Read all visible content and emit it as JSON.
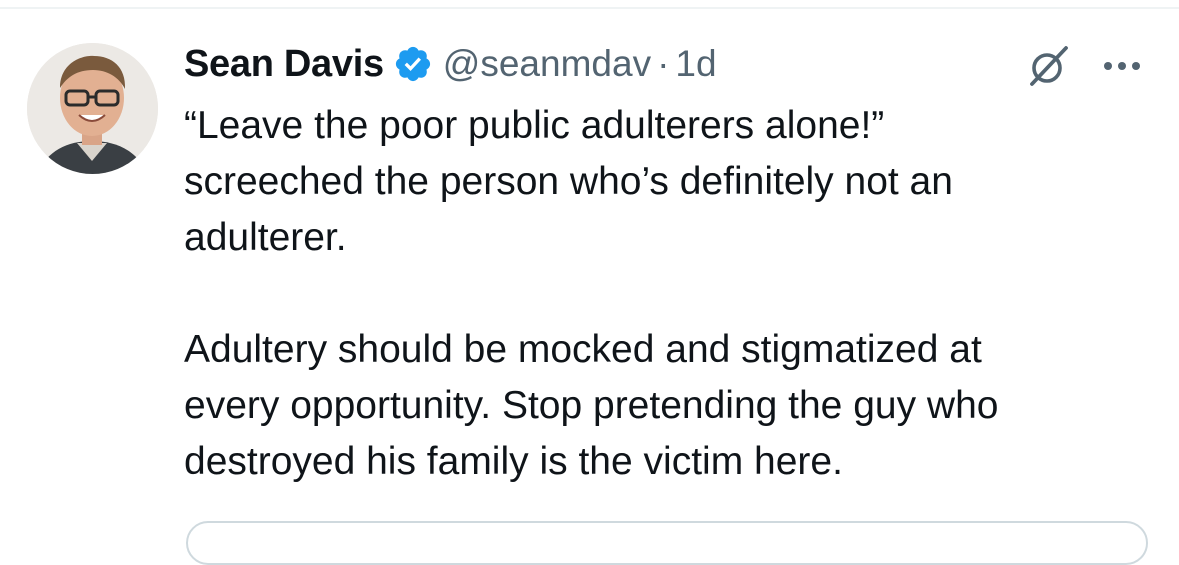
{
  "tweet": {
    "author_name": "Sean Davis",
    "handle": "@seanmdav",
    "separator": "·",
    "time": "1d",
    "verified": true,
    "paragraphs": [
      "“Leave the poor public adulterers alone!”\nscreeched the person who’s definitely not an\nadulterer.",
      "Adultery should be mocked and stigmatized at\nevery opportunity. Stop pretending the guy who\ndestroyed his family is the victim here."
    ]
  },
  "icons": {
    "verified": "verified-badge-icon",
    "grok": "grok-icon",
    "more": "more-icon"
  },
  "colors": {
    "verified_blue": "#1d9bf0",
    "text_primary": "#0f1419",
    "text_secondary": "#536471",
    "border": "#cfd9de"
  }
}
